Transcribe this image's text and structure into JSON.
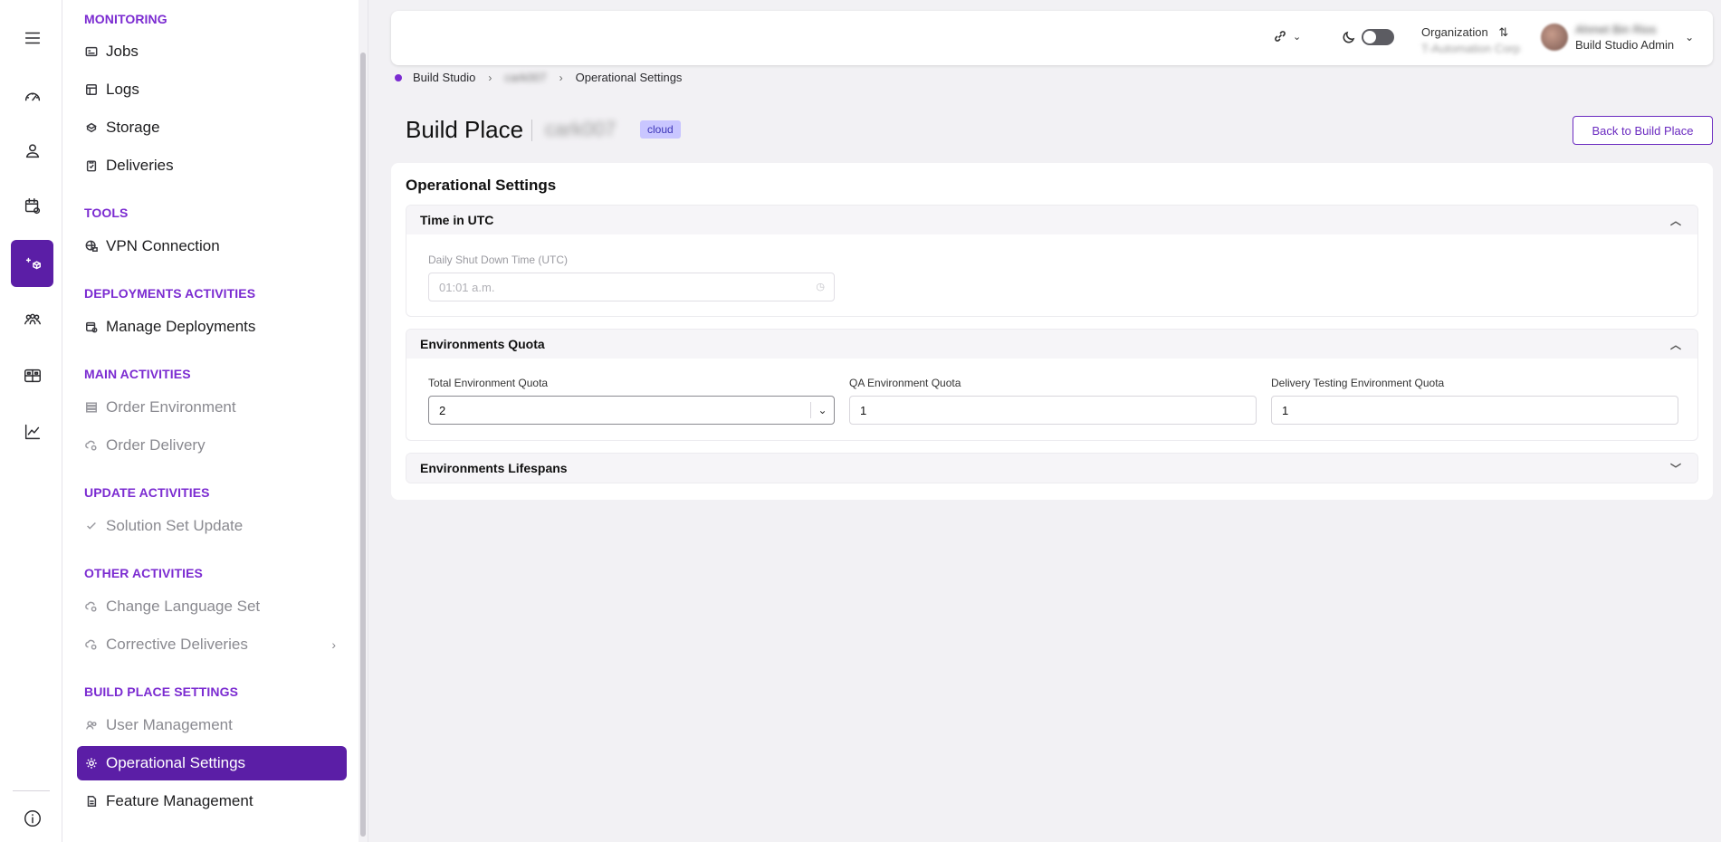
{
  "colors": {
    "accent": "#5b1ea6",
    "section_title": "#7b2bd1",
    "badge_bg": "#c9c6ff"
  },
  "rail": {
    "items": [
      "menu-icon",
      "speedometer-icon",
      "person-icon",
      "calendar-gear-icon",
      "build-place-icon",
      "team-icon",
      "dashboard-icon",
      "chart-icon",
      "info-icon"
    ],
    "active": "build-place-icon"
  },
  "sidebar": {
    "sections": {
      "monitoring": "MONITORING",
      "tools": "TOOLS",
      "deployments": "DEPLOYMENTS ACTIVITIES",
      "main": "MAIN ACTIVITIES",
      "update": "UPDATE ACTIVITIES",
      "other": "OTHER ACTIVITIES",
      "settings": "BUILD PLACE SETTINGS"
    },
    "items": {
      "jobs": "Jobs",
      "logs": "Logs",
      "storage": "Storage",
      "deliveries": "Deliveries",
      "vpn": "VPN Connection",
      "manage_deployments": "Manage Deployments",
      "order_environment": "Order Environment",
      "order_delivery": "Order Delivery",
      "solution_set_update": "Solution Set Update",
      "change_language_set": "Change Language Set",
      "corrective_deliveries": "Corrective Deliveries",
      "user_management": "User Management",
      "operational_settings": "Operational Settings",
      "feature_management": "Feature Management"
    }
  },
  "topbar": {
    "org_label": "Organization",
    "org_name": "T-Automation Corp",
    "user_name": "Ahmet Bin Rios",
    "user_role": "Build Studio Admin"
  },
  "breadcrumb": {
    "root": "Build Studio",
    "place": "cark007",
    "current": "Operational Settings"
  },
  "page": {
    "title": "Build Place",
    "place_id": "cark007",
    "badge": "cloud",
    "back_button": "Back to Build Place"
  },
  "card": {
    "title": "Operational Settings",
    "time_section": {
      "title": "Time in UTC",
      "field_label": "Daily Shut Down Time (UTC)",
      "field_value": "01:01 a.m."
    },
    "quota_section": {
      "title": "Environments Quota",
      "total_label": "Total Environment Quota",
      "total_value": "2",
      "qa_label": "QA Environment Quota",
      "qa_value": "1",
      "delivery_label": "Delivery Testing Environment Quota",
      "delivery_value": "1"
    },
    "lifespans_section": {
      "title": "Environments Lifespans"
    }
  }
}
